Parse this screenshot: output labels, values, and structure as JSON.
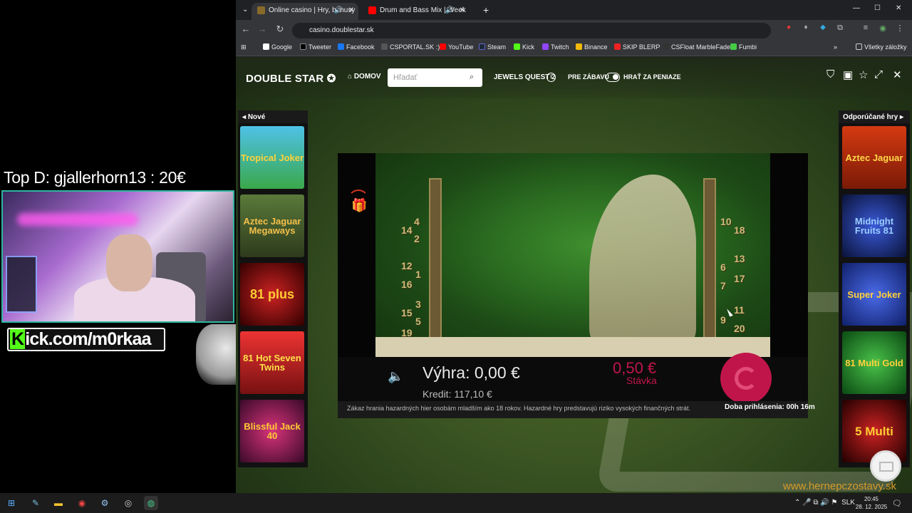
{
  "stream_overlay": {
    "top_donor": "Top D: gjallerhorn13 : 20€",
    "kick_k": "K",
    "kick_rest": "ick.com/m0rkaa",
    "watermark": "www.hernepczostavy.sk"
  },
  "browser": {
    "tabs": [
      {
        "title": "Online casino | Hry, bonusy",
        "active": true
      },
      {
        "title": "Drum and Bass Mix | Week",
        "active": false
      }
    ],
    "url": "casino.doublestar.sk",
    "bookmarks": [
      "Google",
      "Tweeter",
      "Facebook",
      "CSPORTAL.SK :)",
      "YouTube",
      "Steam",
      "Kick",
      "Twitch",
      "Binance",
      "SKIP BLERP",
      "CSFloat MarbleFade",
      "Fumbi"
    ],
    "all_bookmarks": "Všetky záložky"
  },
  "site": {
    "logo_a": "DOUBLE STAR",
    "home": "DOMOV",
    "search_placeholder": "Hľadať",
    "game_title": "JEWELS QUEST 2",
    "fun_label": "PRE ZÁBAVU",
    "money_label": "HRAŤ ZA PENIAZE",
    "new_header": "Nové",
    "recommended_header": "Odporúčané hry",
    "new_games": [
      "Tropical Joker",
      "Aztec Jaguar Megaways",
      "81 plus",
      "81 Hot Seven Twins",
      "Blissful Jack 40"
    ],
    "recommended_games": [
      "Aztec Jaguar",
      "Midnight Fruits 81",
      "Super Joker",
      "81 Multi Gold",
      "5 Multi"
    ]
  },
  "game": {
    "win_text": "Výhra: 0,00 €",
    "credit_text": "Kredit: 117,10 €",
    "bet_value": "0,50 €",
    "bet_label": "Stávka",
    "disclaimer": "Zákaz hrania hazardných hier osobám mladším ako 18 rokov. Hazardné hry predstavujú riziko vysokých finančných strát.",
    "session": "Doba prihlásenia: 00h 16m",
    "left_numbers": [
      "14",
      "4",
      "2",
      "12",
      "1",
      "16",
      "3",
      "15",
      "5",
      "19"
    ],
    "right_numbers": [
      "10",
      "18",
      "6",
      "13",
      "7",
      "17",
      "11",
      "9",
      "20"
    ]
  },
  "taskbar": {
    "lang": "SLK",
    "time": "20:45",
    "date": "28. 12. 2025"
  },
  "colors": {
    "accent": "#c0154b",
    "kick_green": "#53fc18",
    "cam_border": "#2fb6a0"
  }
}
